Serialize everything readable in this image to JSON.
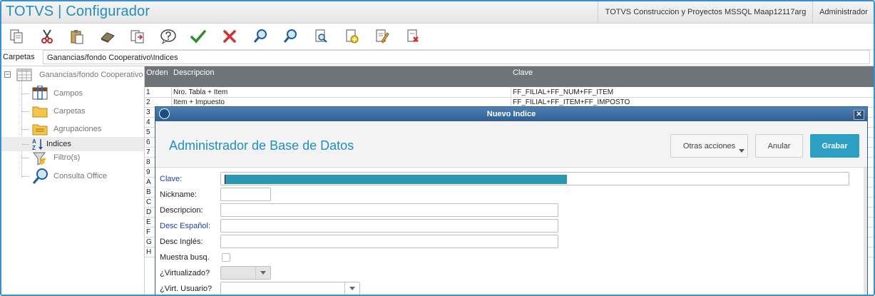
{
  "header": {
    "app_title": "TOTVS | Configurador",
    "company": "TOTVS Construccion y Proyectos MSSQL Maap12117arg",
    "user": "Administrador"
  },
  "toolbar": {
    "buttons": [
      "copy",
      "cut",
      "paste",
      "eraser",
      "copy-structure",
      "help",
      "confirm",
      "cancel",
      "search",
      "search-next",
      "view",
      "add",
      "edit",
      "delete"
    ]
  },
  "pathbar": {
    "label": "Carpetas",
    "value": "Ganancias/fondo Cooperativo\\Indices"
  },
  "tree": {
    "root": "Ganancias/fondo Cooperativo",
    "items": [
      "Campos",
      "Carpetas",
      "Agrupaciones",
      "Indices",
      "Filtro(s)",
      "Consulta Office"
    ],
    "selected": "Indices"
  },
  "grid": {
    "columns": [
      "Orden",
      "Descripcion",
      "Clave"
    ],
    "rows": [
      {
        "orden": "1",
        "descripcion": "Nro. Tabla + Item",
        "clave": "FF_FILIAL+FF_NUM+FF_ITEM"
      },
      {
        "orden": "2",
        "descripcion": "Item + Impuesto",
        "clave": "FF_FILIAL+FF_ITEM+FF_IMPOSTO"
      },
      {
        "orden": "3",
        "descripcion": "",
        "clave": ""
      },
      {
        "orden": "4",
        "descripcion": "",
        "clave": ""
      },
      {
        "orden": "5",
        "descripcion": "",
        "clave": ""
      },
      {
        "orden": "6",
        "descripcion": "",
        "clave": ""
      },
      {
        "orden": "7",
        "descripcion": "",
        "clave": ""
      },
      {
        "orden": "8",
        "descripcion": "",
        "clave": ""
      },
      {
        "orden": "9",
        "descripcion": "",
        "clave": ""
      },
      {
        "orden": "A",
        "descripcion": "",
        "clave": ""
      },
      {
        "orden": "B",
        "descripcion": "",
        "clave": ""
      },
      {
        "orden": "C",
        "descripcion": "",
        "clave": ""
      },
      {
        "orden": "D",
        "descripcion": "",
        "clave": ""
      },
      {
        "orden": "E",
        "descripcion": "",
        "clave": ""
      },
      {
        "orden": "F",
        "descripcion": "",
        "clave": ""
      },
      {
        "orden": "G",
        "descripcion": "",
        "clave": ""
      },
      {
        "orden": "H",
        "descripcion": "",
        "clave": ""
      }
    ]
  },
  "dialog": {
    "title": "Nuevo Indice",
    "heading": "Administrador de Base de Datos",
    "buttons": {
      "otras": "Otras acciones",
      "anular": "Anular",
      "grabar": "Grabar"
    },
    "fields": {
      "clave": {
        "label": "Clave:",
        "value": ""
      },
      "nickname": {
        "label": "Nickname:",
        "value": ""
      },
      "descripcion": {
        "label": "Descripcion:",
        "value": ""
      },
      "desc_espanol": {
        "label": "Desc Español:",
        "value": ""
      },
      "desc_ingles": {
        "label": "Desc Inglés:",
        "value": ""
      },
      "muestra_busq": {
        "label": "Muestra busq.",
        "checked": false
      },
      "virtualizado": {
        "label": "¿Virtualizado?",
        "value": ""
      },
      "virt_usuario": {
        "label": "¿Virt. Usuario?",
        "value": ""
      }
    }
  },
  "colors": {
    "accent": "#1f8fc2",
    "grabar": "#2c9fc3",
    "dialog_title": "#3a6a9c",
    "grid_header": "#6f7478"
  }
}
